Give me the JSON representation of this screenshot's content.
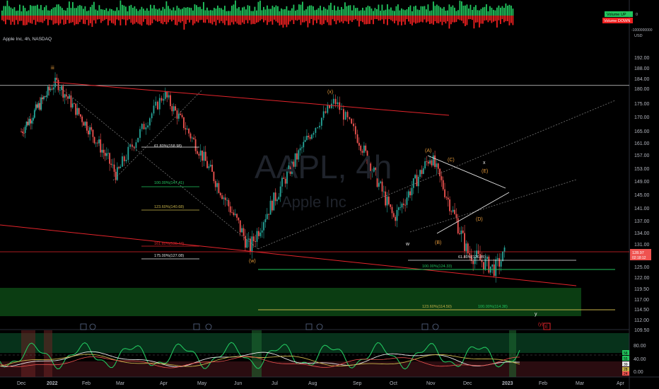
{
  "header": {
    "symbol_line": "Apple Inc, 4h, NASDAQ",
    "watermark_ticker": "AAPL, 4h",
    "watermark_name": "Apple Inc"
  },
  "volume_pane": {
    "legend_up": "Volume UP",
    "legend_down": "Volume DOWN",
    "scale_top": "0",
    "scale_bottom": "-1000000000"
  },
  "price_axis": {
    "currency": "USD",
    "ticks": [
      "192.00",
      "188.00",
      "184.00",
      "180.00",
      "175.00",
      "170.00",
      "165.00",
      "161.00",
      "157.00",
      "153.00",
      "149.00",
      "145.00",
      "141.00",
      "137.00",
      "134.00",
      "131.00",
      "128.00",
      "125.00",
      "122.00",
      "119.50",
      "117.00",
      "114.50",
      "112.00",
      "109.50"
    ],
    "last_price": "128.97",
    "countdown": "02:18:12"
  },
  "time_axis": [
    "Dec",
    "2022",
    "Feb",
    "Mar",
    "Apr",
    "May",
    "Jun",
    "Jul",
    "Aug",
    "Sep",
    "Oct",
    "Nov",
    "Dec",
    "2023",
    "Feb",
    "Mar",
    "Apr"
  ],
  "wave_labels": {
    "iii": "iii",
    "x_paren": "(x)",
    "w_paren": "(w)",
    "w": "w",
    "x": "x",
    "y": "y",
    "y_paren": "(y)",
    "A": "(A)",
    "B": "(B)",
    "C": "(C)",
    "D": "(D)",
    "E": "(E)"
  },
  "fib_labels": {
    "f1": "61.80%(158.98)",
    "f2": "100.00%(147.41)",
    "f3": "123.60%(140.68)",
    "f4": "161.80%(130.44)",
    "f5": "175.00%(127.08)",
    "f6": "61.80%(126.85)",
    "f7": "100.00%(124.33)",
    "f8": "123.60%(114.50)",
    "f9": "100.00%(114.38)"
  },
  "event_badge": "E",
  "oscillator": {
    "ticks": [
      "80.00",
      "40.00",
      "0.00"
    ],
    "readouts": [
      "58",
      "55",
      "39",
      "28",
      "24"
    ]
  },
  "colors": {
    "up": "#26a69a",
    "down": "#ef5350",
    "vol_up": "#22c55e",
    "vol_down": "#ef2020",
    "trendline": "#e3242b",
    "fib_green": "#22c55e",
    "fib_yellow": "#c8b44a",
    "fib_red": "#e3242b",
    "label_orange": "#e59a3a"
  },
  "chart_data": {
    "type": "candlestick",
    "title": "Apple Inc, 4h, NASDAQ",
    "ylim": [
      107.5,
      200
    ],
    "x": [
      "Dec",
      "2022",
      "Feb",
      "Mar",
      "Apr",
      "May",
      "Jun",
      "Jul",
      "Aug",
      "Sep",
      "Oct",
      "Nov",
      "Dec",
      "2023",
      "Feb",
      "Mar",
      "Apr"
    ],
    "swing_path": [
      {
        "t": "Dec 2021",
        "price": 165
      },
      {
        "t": "Jan 2022",
        "price": 182.9
      },
      {
        "t": "Mar 2022",
        "price": 151
      },
      {
        "t": "Apr 2022",
        "price": 178.5
      },
      {
        "t": "Jun 2022",
        "price": 130
      },
      {
        "t": "Aug 2022",
        "price": 176
      },
      {
        "t": "Oct 2022",
        "price": 138
      },
      {
        "t": "Nov 2022",
        "price": 157
      },
      {
        "t": "Dec 2022",
        "price": 129
      },
      {
        "t": "Jan 2023",
        "price": 124.5
      },
      {
        "t": "Jan 2023",
        "price": 128.97
      }
    ],
    "fib_levels": [
      158.98,
      147.41,
      140.68,
      130.44,
      127.08,
      126.85,
      124.33,
      114.5,
      114.38
    ],
    "horizontal_lines": [
      181.5,
      129.5
    ]
  }
}
